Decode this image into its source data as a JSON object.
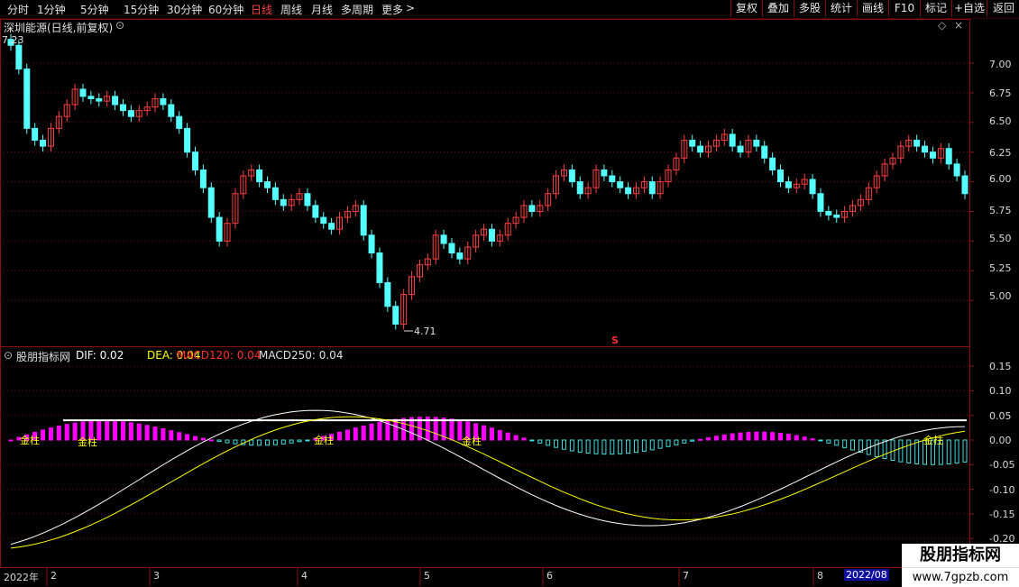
{
  "toolbar": {
    "periods": [
      "分时",
      "1分钟",
      "5分钟",
      "15分钟",
      "30分钟",
      "60分钟",
      "日线",
      "周线",
      "月线",
      "多周期",
      "更多"
    ],
    "active_period": "日线",
    "more_arrow": ">",
    "buttons": [
      "复权",
      "叠加",
      "多股",
      "统计",
      "画线",
      "F10",
      "标记",
      "+自选",
      "返回"
    ]
  },
  "main_chart": {
    "title": "深圳能源(日线,前复权)",
    "price_axis": [
      "7.00",
      "6.75",
      "6.50",
      "6.25",
      "6.00",
      "5.75",
      "5.50",
      "5.25",
      "5.00"
    ],
    "high_marker": "7.23",
    "low_marker": "4.71",
    "signal_mark": "S"
  },
  "indicator": {
    "name": "股朋指标网",
    "dif_label": "DIF: 0.02",
    "dea_label": "DEA: 0.04",
    "macd120_label": "MACD120: 0.04",
    "macd250_label": "MACD250: 0.04",
    "axis": [
      "0.15",
      "0.10",
      "0.05",
      "0.00",
      "-0.05",
      "-0.10",
      "-0.15",
      "-0.20"
    ],
    "tags": [
      "金柱",
      "金柱",
      "金柱",
      "金柱",
      "金柱"
    ],
    "colors": {
      "dif": "#ffffff",
      "dea": "#ffff00",
      "macd120": "#ff3030",
      "positive_bar": "#ff00ff",
      "negative_bar": "#40e0e0",
      "gold_bar": "#ffff00"
    }
  },
  "timeline": [
    "2022年",
    "2",
    "3",
    "4",
    "5",
    "6",
    "7",
    "8",
    "2022/08"
  ],
  "watermark": {
    "title": "股朋指标网",
    "url": "www.7gpzb.com"
  }
}
